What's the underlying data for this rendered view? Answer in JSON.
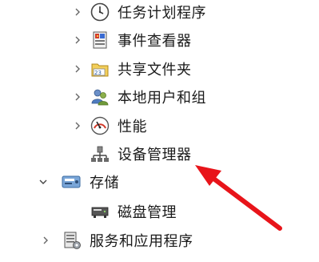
{
  "tree": {
    "items": [
      {
        "label": "任务计划程序",
        "icon": "clock-icon"
      },
      {
        "label": "事件查看器",
        "icon": "event-viewer-icon"
      },
      {
        "label": "共享文件夹",
        "icon": "shared-folder-icon"
      },
      {
        "label": "本地用户和组",
        "icon": "users-icon"
      },
      {
        "label": "性能",
        "icon": "performance-icon"
      },
      {
        "label": "设备管理器",
        "icon": "device-manager-icon"
      },
      {
        "label": "存储",
        "icon": "storage-icon"
      },
      {
        "label": "磁盘管理",
        "icon": "disk-icon"
      },
      {
        "label": "服务和应用程序",
        "icon": "services-icon"
      }
    ]
  },
  "annotation": {
    "arrow_color": "#e8141a"
  }
}
